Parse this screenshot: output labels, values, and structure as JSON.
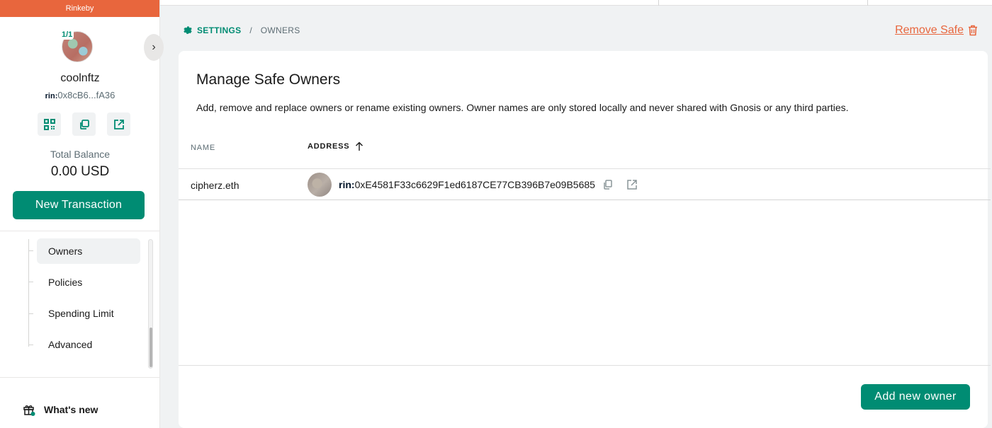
{
  "network": {
    "name": "Rinkeby",
    "color": "#e8663d"
  },
  "safe": {
    "threshold": "1/1",
    "name": "coolnftz",
    "address_prefix": "rin:",
    "address_short": "0x8cB6...fA36",
    "balance_label": "Total Balance",
    "balance_value": "0.00 USD"
  },
  "sidebar": {
    "icons": [
      "qr-code-icon",
      "copy-icon",
      "external-link-icon"
    ],
    "new_transaction_label": "New Transaction",
    "nav_items": [
      {
        "label": "Owners",
        "active": true
      },
      {
        "label": "Policies",
        "active": false
      },
      {
        "label": "Spending Limit",
        "active": false
      },
      {
        "label": "Advanced",
        "active": false
      }
    ],
    "whats_new_label": "What's new"
  },
  "header": {
    "breadcrumb": {
      "section": "SETTINGS",
      "separator": "/",
      "page": "OWNERS"
    },
    "remove_safe_label": "Remove Safe"
  },
  "owners_card": {
    "title": "Manage Safe Owners",
    "description": "Add, remove and replace owners or rename existing owners. Owner names are only stored locally and never shared with Gnosis or any third parties.",
    "columns": [
      "NAME",
      "ADDRESS"
    ],
    "rows": [
      {
        "name": "cipherz.eth",
        "address_prefix": "rin:",
        "address": "0xE4581F33c6629F1ed6187CE77CB396B7e09B5685"
      }
    ],
    "add_owner_label": "Add new owner"
  },
  "colors": {
    "primary": "#008c73",
    "danger": "#e8663d",
    "text": "#001428"
  }
}
